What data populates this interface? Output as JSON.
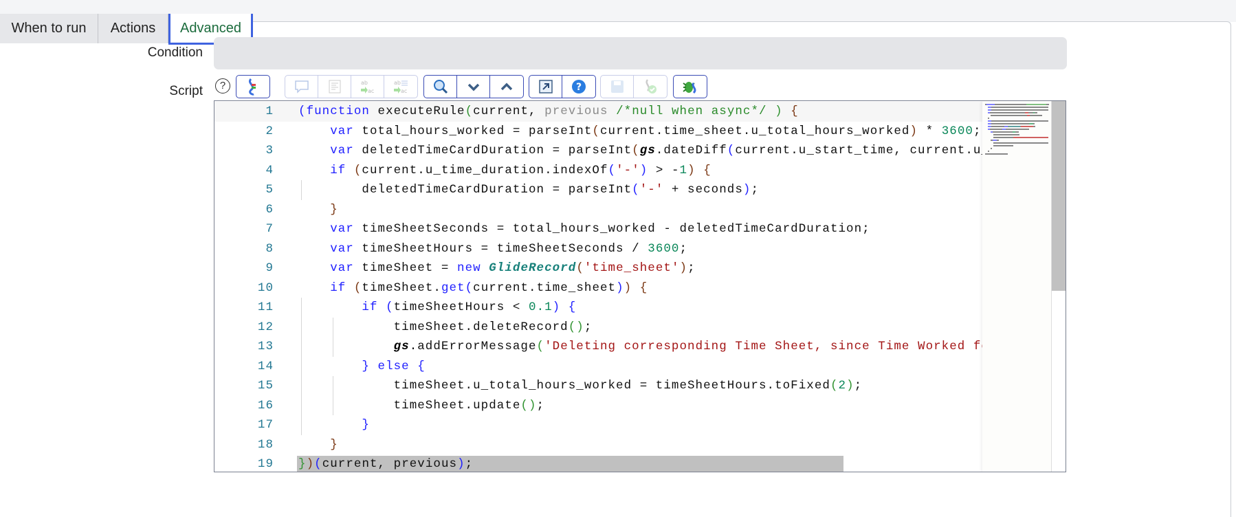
{
  "tabs": [
    {
      "label": "When to run"
    },
    {
      "label": "Actions"
    },
    {
      "label": "Advanced",
      "active": true
    }
  ],
  "form": {
    "condition_label": "Condition",
    "condition_value": "",
    "script_label": "Script",
    "help_glyph": "?"
  },
  "toolbar": {
    "groups": [
      {
        "disabled": false,
        "buttons": [
          "script-include-icon"
        ]
      },
      {
        "disabled": true,
        "buttons": [
          "comment-icon",
          "format-icon",
          "replace-icon",
          "replace-all-icon"
        ]
      },
      {
        "disabled": false,
        "buttons": [
          "search-icon",
          "find-next-icon",
          "find-previous-icon"
        ]
      },
      {
        "disabled": false,
        "buttons": [
          "fullscreen-icon",
          "help-icon"
        ]
      },
      {
        "disabled": true,
        "buttons": [
          "save-icon",
          "check-syntax-icon"
        ]
      },
      {
        "disabled": false,
        "buttons": [
          "debug-icon"
        ]
      }
    ]
  },
  "code": {
    "lines": [
      {
        "n": "1",
        "indent": 0,
        "tokens": [
          {
            "c": "b1",
            "t": "("
          },
          {
            "c": "kw",
            "t": "function"
          },
          {
            "c": "pl",
            "t": " executeRule"
          },
          {
            "c": "b2",
            "t": "("
          },
          {
            "c": "pl",
            "t": "current, "
          },
          {
            "c": "prm",
            "t": "previous "
          },
          {
            "c": "cm",
            "t": "/*null when async*/"
          },
          {
            "c": "pl",
            "t": " "
          },
          {
            "c": "b2",
            "t": ")"
          },
          {
            "c": "pl",
            "t": " "
          },
          {
            "c": "b3",
            "t": "{"
          }
        ]
      },
      {
        "n": "2",
        "indent": 1,
        "tokens": [
          {
            "c": "kw",
            "t": "var"
          },
          {
            "c": "pl",
            "t": " total_hours_worked = parseInt"
          },
          {
            "c": "b3",
            "t": "("
          },
          {
            "c": "pl",
            "t": "current.time_sheet.u_total_hours_worked"
          },
          {
            "c": "b3",
            "t": ")"
          },
          {
            "c": "pl",
            "t": " * "
          },
          {
            "c": "num",
            "t": "3600"
          },
          {
            "c": "pl",
            "t": ";"
          }
        ]
      },
      {
        "n": "3",
        "indent": 1,
        "tokens": [
          {
            "c": "kw",
            "t": "var"
          },
          {
            "c": "pl",
            "t": " deletedTimeCardDuration = parseInt"
          },
          {
            "c": "b3",
            "t": "("
          },
          {
            "c": "gs",
            "t": "gs"
          },
          {
            "c": "pl",
            "t": ".dateDiff"
          },
          {
            "c": "b1",
            "t": "("
          },
          {
            "c": "pl",
            "t": "current.u_start_time, current.u_"
          }
        ]
      },
      {
        "n": "4",
        "indent": 1,
        "tokens": [
          {
            "c": "kw",
            "t": "if"
          },
          {
            "c": "pl",
            "t": " "
          },
          {
            "c": "b3",
            "t": "("
          },
          {
            "c": "pl",
            "t": "current.u_time_duration.indexOf"
          },
          {
            "c": "b1",
            "t": "("
          },
          {
            "c": "str",
            "t": "'-'"
          },
          {
            "c": "b1",
            "t": ")"
          },
          {
            "c": "pl",
            "t": " > -"
          },
          {
            "c": "num",
            "t": "1"
          },
          {
            "c": "b3",
            "t": ")"
          },
          {
            "c": "pl",
            "t": " "
          },
          {
            "c": "b3",
            "t": "{"
          }
        ]
      },
      {
        "n": "5",
        "indent": 2,
        "tokens": [
          {
            "c": "pl",
            "t": "deletedTimeCardDuration = parseInt"
          },
          {
            "c": "b1",
            "t": "("
          },
          {
            "c": "str",
            "t": "'-'"
          },
          {
            "c": "pl",
            "t": " + seconds"
          },
          {
            "c": "b1",
            "t": ")"
          },
          {
            "c": "pl",
            "t": ";"
          }
        ]
      },
      {
        "n": "6",
        "indent": 1,
        "tokens": [
          {
            "c": "b3",
            "t": "}"
          }
        ]
      },
      {
        "n": "7",
        "indent": 1,
        "tokens": [
          {
            "c": "kw",
            "t": "var"
          },
          {
            "c": "pl",
            "t": " timeSheetSeconds = total_hours_worked - deletedTimeCardDuration;"
          }
        ]
      },
      {
        "n": "8",
        "indent": 1,
        "tokens": [
          {
            "c": "kw",
            "t": "var"
          },
          {
            "c": "pl",
            "t": " timeSheetHours = timeSheetSeconds / "
          },
          {
            "c": "num",
            "t": "3600"
          },
          {
            "c": "pl",
            "t": ";"
          }
        ]
      },
      {
        "n": "9",
        "indent": 1,
        "tokens": [
          {
            "c": "kw",
            "t": "var"
          },
          {
            "c": "pl",
            "t": " timeSheet = "
          },
          {
            "c": "kw",
            "t": "new"
          },
          {
            "c": "pl",
            "t": " "
          },
          {
            "c": "cls",
            "t": "GlideRecord"
          },
          {
            "c": "b3",
            "t": "("
          },
          {
            "c": "str",
            "t": "'time_sheet'"
          },
          {
            "c": "b3",
            "t": ")"
          },
          {
            "c": "pl",
            "t": ";"
          }
        ]
      },
      {
        "n": "10",
        "indent": 1,
        "tokens": [
          {
            "c": "kw",
            "t": "if"
          },
          {
            "c": "pl",
            "t": " "
          },
          {
            "c": "b3",
            "t": "("
          },
          {
            "c": "pl",
            "t": "timeSheet."
          },
          {
            "c": "kw",
            "t": "get"
          },
          {
            "c": "b1",
            "t": "("
          },
          {
            "c": "pl",
            "t": "current.time_sheet"
          },
          {
            "c": "b1",
            "t": ")"
          },
          {
            "c": "b3",
            "t": ")"
          },
          {
            "c": "pl",
            "t": " "
          },
          {
            "c": "b3",
            "t": "{"
          }
        ]
      },
      {
        "n": "11",
        "indent": 2,
        "tokens": [
          {
            "c": "kw",
            "t": "if"
          },
          {
            "c": "pl",
            "t": " "
          },
          {
            "c": "b1",
            "t": "("
          },
          {
            "c": "pl",
            "t": "timeSheetHours < "
          },
          {
            "c": "num",
            "t": "0.1"
          },
          {
            "c": "b1",
            "t": ")"
          },
          {
            "c": "pl",
            "t": " "
          },
          {
            "c": "b1",
            "t": "{"
          }
        ]
      },
      {
        "n": "12",
        "indent": 3,
        "tokens": [
          {
            "c": "pl",
            "t": "timeSheet.deleteRecord"
          },
          {
            "c": "b2",
            "t": "()"
          },
          {
            "c": "pl",
            "t": ";"
          }
        ]
      },
      {
        "n": "13",
        "indent": 3,
        "tokens": [
          {
            "c": "gs",
            "t": "gs"
          },
          {
            "c": "pl",
            "t": ".addErrorMessage"
          },
          {
            "c": "b2",
            "t": "("
          },
          {
            "c": "str",
            "t": "'Deleting corresponding Time Sheet, since Time Worked fo"
          }
        ]
      },
      {
        "n": "14",
        "indent": 2,
        "tokens": [
          {
            "c": "b1",
            "t": "}"
          },
          {
            "c": "pl",
            "t": " "
          },
          {
            "c": "kw",
            "t": "else"
          },
          {
            "c": "pl",
            "t": " "
          },
          {
            "c": "b1",
            "t": "{"
          }
        ]
      },
      {
        "n": "15",
        "indent": 3,
        "tokens": [
          {
            "c": "pl",
            "t": "timeSheet.u_total_hours_worked = timeSheetHours.toFixed"
          },
          {
            "c": "b2",
            "t": "("
          },
          {
            "c": "num",
            "t": "2"
          },
          {
            "c": "b2",
            "t": ")"
          },
          {
            "c": "pl",
            "t": ";"
          }
        ]
      },
      {
        "n": "16",
        "indent": 3,
        "tokens": [
          {
            "c": "pl",
            "t": "timeSheet.update"
          },
          {
            "c": "b2",
            "t": "()"
          },
          {
            "c": "pl",
            "t": ";"
          }
        ]
      },
      {
        "n": "17",
        "indent": 2,
        "tokens": [
          {
            "c": "b1",
            "t": "}"
          }
        ]
      },
      {
        "n": "18",
        "indent": 1,
        "tokens": [
          {
            "c": "b3",
            "t": "}"
          }
        ]
      },
      {
        "n": "19",
        "indent": 0,
        "tokens": [
          {
            "c": "b2",
            "t": "}"
          },
          {
            "c": "b3",
            "t": ")"
          },
          {
            "c": "b1",
            "t": "("
          },
          {
            "c": "pl",
            "t": "current, previous"
          },
          {
            "c": "b1",
            "t": ")"
          },
          {
            "c": "pl",
            "t": ";"
          }
        ]
      }
    ]
  },
  "colors": {
    "accent": "#3f63e0",
    "keyword": "#1f1fff",
    "string": "#a31515",
    "number": "#098658",
    "line_number": "#237893"
  }
}
